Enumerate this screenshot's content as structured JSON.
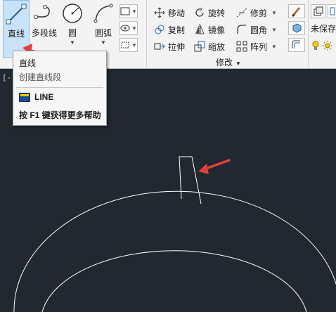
{
  "draw_panel": {
    "line_label": "直线",
    "polyline_label": "多段线",
    "circle_label": "圆",
    "arc_label": "圆弧"
  },
  "modify_panel": {
    "title": "修改",
    "move": "移动",
    "rotate": "旋转",
    "trim": "修剪",
    "copy": "复制",
    "mirror": "镜像",
    "fillet": "圆角",
    "stretch": "拉伸",
    "scale": "缩放",
    "array": "阵列"
  },
  "layers_panel": {
    "layer_name": "未保存"
  },
  "viewport": {
    "control_label": "[-"
  },
  "tooltip": {
    "title": "直线",
    "description": "创建直线段",
    "command": "LINE",
    "help": "按 F1 键获得更多帮助"
  },
  "colors": {
    "canvas": "#212830",
    "ribbon": "#f3f3f3",
    "annotation_arrow": "#e0403a",
    "drawing_lines": "#ffffff"
  }
}
